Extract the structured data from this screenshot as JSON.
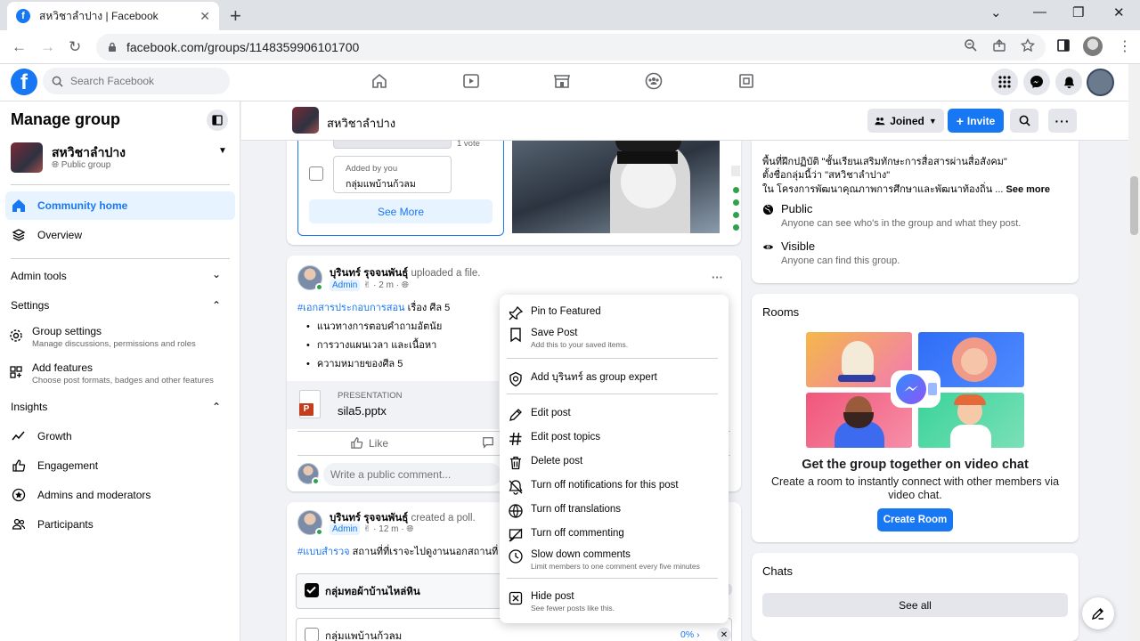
{
  "browser": {
    "tab_title": "สหวิชาลำปาง | Facebook",
    "url": "facebook.com/groups/1148359906101700"
  },
  "fb": {
    "search_placeholder": "Search Facebook"
  },
  "sidebar": {
    "title": "Manage group",
    "group_name": "สหวิชาลำปาง",
    "group_privacy": "Public group",
    "community_home": "Community home",
    "overview": "Overview",
    "admin_tools": "Admin tools",
    "settings": "Settings",
    "group_settings": "Group settings",
    "group_settings_desc": "Manage discussions, permissions and roles",
    "add_features": "Add features",
    "add_features_desc": "Choose post formats, badges and other features",
    "insights": "Insights",
    "growth": "Growth",
    "engagement": "Engagement",
    "admins_moderators": "Admins and moderators",
    "participants": "Participants"
  },
  "group_header": {
    "name": "สหวิชาลำปาง",
    "joined": "Joined",
    "invite": "Invite"
  },
  "poll_card": {
    "vote_count": "1 vote",
    "added_by": "Added by you",
    "option": "กลุ่มแพบ้านก้วลม",
    "see_more": "See More"
  },
  "post1": {
    "author": "บุรินทร์ รุจจนพันธุ์",
    "action": "uploaded a file.",
    "badge": "Admin",
    "time": "· 2 m ·",
    "hashtag": "#เอกสารประกอบการสอน",
    "text": "เรื่อง ศีล 5",
    "bullets": [
      "แนวทางการตอบคำถามอัตนัย",
      "การวางแผนเวลา และเนื้อหา",
      "ความหมายของศีล 5"
    ],
    "file_type": "PRESENTATION",
    "file_name": "sila5.pptx",
    "like": "Like",
    "comment_placeholder": "Write a public comment..."
  },
  "post2": {
    "author": "บุรินทร์ รุจจนพันธุ์",
    "action": "created a poll.",
    "badge": "Admin",
    "time": "· 12 m ·",
    "hashtag": "#แบบสำรวจ",
    "text": "สถานที่ที่เราจะไปดูงานนอกสถานที่",
    "option1": "กลุ่มทอผ้าบ้านไหล่หิน",
    "option2": "กลุ่มแพบ้านก้วลม",
    "option2_pct": "0%"
  },
  "menu": {
    "pin": "Pin to Featured",
    "save": "Save Post",
    "save_desc": "Add this to your saved items.",
    "expert": "Add บุรินทร์ as group expert",
    "edit": "Edit post",
    "edit_topics": "Edit post topics",
    "delete": "Delete post",
    "notif_off": "Turn off notifications for this post",
    "trans_off": "Turn off translations",
    "comment_off": "Turn off commenting",
    "slow": "Slow down comments",
    "slow_desc": "Limit members to one comment every five minutes",
    "hide": "Hide post",
    "hide_desc": "See fewer posts like this."
  },
  "about": {
    "line1": "พื้นที่ฝึกปฏิบัติ \"ชั้นเรียนเสริมทักษะการสื่อสารผ่านสื่อสังคม\"",
    "line2": "ตั้งชื่อกลุ่มนี้ว่า \"สหวิชาลำปาง\"",
    "line3": "ใน โครงการพัฒนาคุณภาพการศึกษาและพัฒนาท้องถิ่น ...",
    "see_more": "See more",
    "public": "Public",
    "public_desc": "Anyone can see who's in the group and what they post.",
    "visible": "Visible",
    "visible_desc": "Anyone can find this group."
  },
  "rooms": {
    "title": "Rooms",
    "heading": "Get the group together on video chat",
    "desc": "Create a room to instantly connect with other members via video chat.",
    "button": "Create Room"
  },
  "chats": {
    "title": "Chats",
    "see_all": "See all"
  },
  "colors": {
    "fb_blue": "#1877f2",
    "online_green": "#31a24c"
  }
}
